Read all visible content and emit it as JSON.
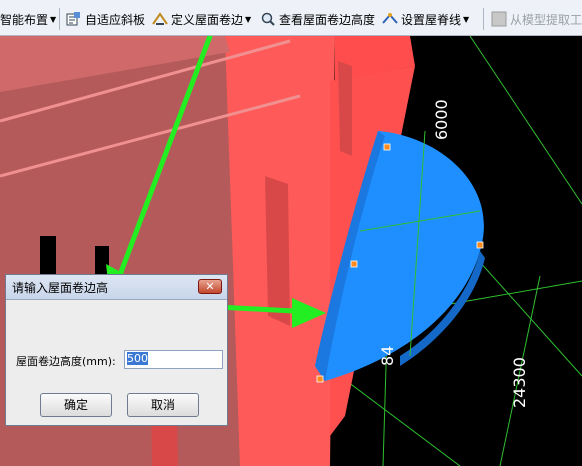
{
  "toolbar": {
    "items": [
      {
        "label": "智能布置",
        "icon": "smart-layout-icon",
        "dropdown": true
      },
      {
        "label": "自适应斜板",
        "icon": "adaptive-slab-icon",
        "dropdown": false
      },
      {
        "label": "定义屋面卷边",
        "icon": "define-roof-edge-icon",
        "dropdown": true
      },
      {
        "label": "查看屋面卷边高度",
        "icon": "view-edge-height-icon",
        "dropdown": false
      },
      {
        "label": "设置屋脊线",
        "icon": "ridge-line-icon",
        "dropdown": true
      },
      {
        "label": "从模型提取工",
        "icon": "extract-from-model-icon",
        "dropdown": false,
        "disabled": true
      }
    ]
  },
  "viewport": {
    "axis_labels": [
      "6000",
      "84",
      "24300"
    ],
    "colors": {
      "background": "#000000",
      "slab": "#ff5a5a",
      "dome": "#1f8fff",
      "grid": "#2fbf2f",
      "arrow": "#22ee22"
    }
  },
  "dialog": {
    "title": "请输入屋面卷边高",
    "close_label": "✕",
    "field_label": "屋面卷边高度(mm):",
    "field_value": "500",
    "ok_label": "确定",
    "cancel_label": "取消"
  }
}
